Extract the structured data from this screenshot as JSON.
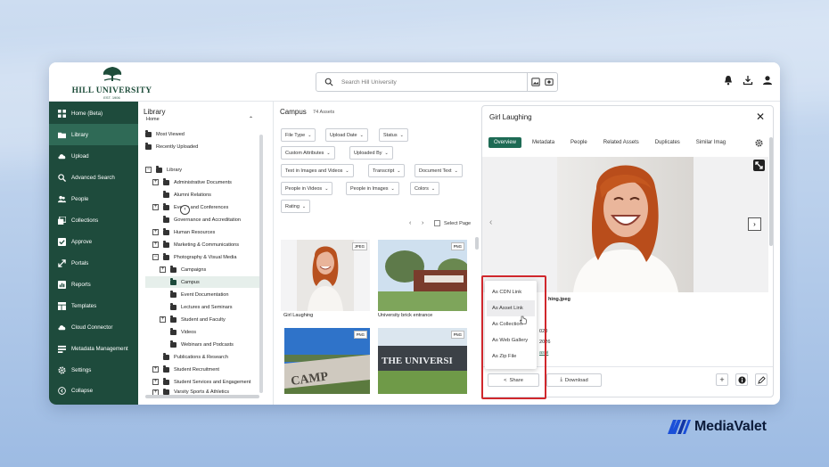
{
  "brand": {
    "logo_name": "HILL UNIVERSITY",
    "logo_est": "EST. 1906",
    "watermark": "MediaValet",
    "accent": "#1e4b3c"
  },
  "search": {
    "placeholder": "Search Hill University"
  },
  "sidebar": {
    "items": [
      {
        "label": "Home (Beta)",
        "icon": "grid-icon"
      },
      {
        "label": "Library",
        "icon": "folder-icon"
      },
      {
        "label": "Upload",
        "icon": "cloud-upload-icon"
      },
      {
        "label": "Advanced Search",
        "icon": "search-settings-icon"
      },
      {
        "label": "People",
        "icon": "people-icon"
      },
      {
        "label": "Collections",
        "icon": "collections-icon"
      },
      {
        "label": "Approve",
        "icon": "approve-icon"
      },
      {
        "label": "Portals",
        "icon": "portals-icon"
      },
      {
        "label": "Reports",
        "icon": "reports-icon"
      },
      {
        "label": "Templates",
        "icon": "templates-icon"
      },
      {
        "label": "Cloud Connector",
        "icon": "cloud-icon"
      },
      {
        "label": "Metadata Management",
        "icon": "metadata-icon"
      },
      {
        "label": "Settings",
        "icon": "gear-icon"
      }
    ],
    "active": "Library",
    "collapse": "Collapse"
  },
  "tree": {
    "title": "Library",
    "subtitle": "Home",
    "quick": [
      "Most Viewed",
      "Recently Uploaded"
    ],
    "rows": [
      "Library",
      "Administrative Documents",
      "Alumni Relations",
      "Events and Conferences",
      "Governance and Accreditation",
      "Human Resources",
      "Marketing & Communications",
      "Photography & Visual Media",
      "Campaigns",
      "Campus",
      "Event Documentation",
      "Lectures and Seminars",
      "Student and Faculty",
      "Videos",
      "Webinars and Podcasts",
      "Publications & Research",
      "Student Recruitment",
      "Student Services and Engagement",
      "Varsity Sports & Athletics"
    ]
  },
  "main": {
    "title": "Campus",
    "count": "74 Assets",
    "filters": [
      "File Type",
      "Upload Date",
      "Status",
      "Custom Attributes",
      "Uploaded By",
      "Text in Images and Videos",
      "Transcript",
      "Document Text",
      "People in Videos",
      "People in Images",
      "Colors",
      "Rating"
    ],
    "select_page": "Select Page",
    "assets": [
      {
        "caption": "Girl Laughing",
        "type": "JPEG"
      },
      {
        "caption": "University brick entrance",
        "type": "PNG"
      },
      {
        "caption": "",
        "type": "PNG"
      },
      {
        "caption": "",
        "type": "PNG"
      }
    ]
  },
  "detail": {
    "title": "Girl Laughing",
    "tabs": [
      "Overview",
      "Metadata",
      "People",
      "Related Assets",
      "Duplicates",
      "Similar Imag"
    ],
    "meta": [
      "hing.jpeg",
      "020",
      "2026",
      "ashi"
    ],
    "share": "Share",
    "download": "Download",
    "share_menu": [
      "As CDN Link",
      "As Asset Link",
      "As Collection",
      "As Web Gallery",
      "As Zip File"
    ]
  }
}
